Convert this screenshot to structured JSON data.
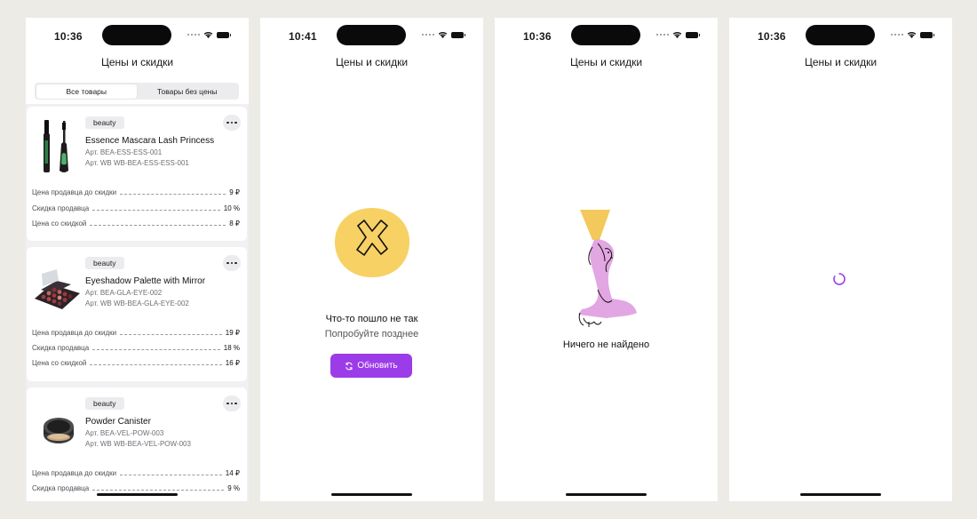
{
  "colors": {
    "accent": "#9b3ce8",
    "background": "#ecebe6",
    "error_yellow": "#f7d164",
    "figure_pink": "#e2a6e2",
    "lamp_yellow": "#f2c95a"
  },
  "screens": [
    {
      "status_time": "10:36",
      "title": "Цены и скидки",
      "tabs": [
        {
          "label": "Все товары",
          "active": true
        },
        {
          "label": "Товары без цены",
          "active": false
        }
      ],
      "products": [
        {
          "category": "beauty",
          "name": "Essence Mascara Lash Princess",
          "article": "Арт. BEA-ESS-ESS-001",
          "article_wb": "Арт. WB WB-BEA-ESS-ESS-001",
          "image_icon": "mascara-image",
          "prices": [
            {
              "label": "Цена продавца до скидки",
              "value": "9 ₽"
            },
            {
              "label": "Скидка продавца",
              "value": "10 %"
            },
            {
              "label": "Цена со скидкой",
              "value": "8 ₽"
            }
          ]
        },
        {
          "category": "beauty",
          "name": "Eyeshadow Palette with Mirror",
          "article": "Арт. BEA-GLA-EYE-002",
          "article_wb": "Арт. WB WB-BEA-GLA-EYE-002",
          "image_icon": "eyeshadow-palette-image",
          "prices": [
            {
              "label": "Цена продавца до скидки",
              "value": "19 ₽"
            },
            {
              "label": "Скидка продавца",
              "value": "18 %"
            },
            {
              "label": "Цена со скидкой",
              "value": "16 ₽"
            }
          ]
        },
        {
          "category": "beauty",
          "name": "Powder Canister",
          "article": "Арт. BEA-VEL-POW-003",
          "article_wb": "Арт. WB WB-BEA-VEL-POW-003",
          "image_icon": "powder-canister-image",
          "prices": [
            {
              "label": "Цена продавца до скидки",
              "value": "14 ₽"
            },
            {
              "label": "Скидка продавца",
              "value": "9 %"
            }
          ]
        }
      ]
    },
    {
      "status_time": "10:41",
      "title": "Цены и скидки",
      "error_title": "Что-то пошло не так",
      "error_subtitle": "Попробуйте позднее",
      "refresh_label": "Обновить"
    },
    {
      "status_time": "10:36",
      "title": "Цены и скидки",
      "empty_text": "Ничего не найдено"
    },
    {
      "status_time": "10:36",
      "title": "Цены и скидки"
    }
  ]
}
